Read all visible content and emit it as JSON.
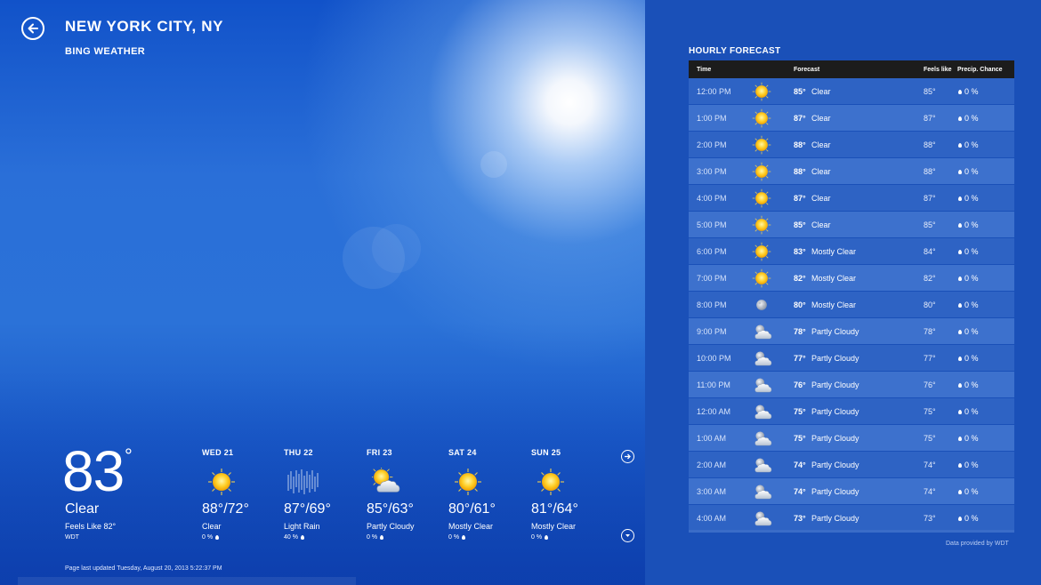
{
  "header": {
    "city": "NEW YORK CITY, NY",
    "app_name": "BING WEATHER"
  },
  "current": {
    "temp": "83",
    "degree": "°",
    "condition": "Clear",
    "feels_like": "Feels Like 82°",
    "provider": "WDT",
    "updated": "Page last updated Tuesday, August 20, 2013 5:22:37 PM"
  },
  "daily": [
    {
      "day": "WED 21",
      "temp": "88°/72°",
      "cond": "Clear",
      "precip": "0 %",
      "icon": "sun-icon"
    },
    {
      "day": "THU 22",
      "temp": "87°/69°",
      "cond": "Light Rain",
      "precip": "40 %",
      "icon": "rain-icon"
    },
    {
      "day": "FRI 23",
      "temp": "85°/63°",
      "cond": "Partly Cloudy",
      "precip": "0 %",
      "icon": "partly-cloudy-icon"
    },
    {
      "day": "SAT 24",
      "temp": "80°/61°",
      "cond": "Mostly Clear",
      "precip": "0 %",
      "icon": "sun-icon"
    },
    {
      "day": "SUN 25",
      "temp": "81°/64°",
      "cond": "Mostly Clear",
      "precip": "0 %",
      "icon": "sun-icon"
    }
  ],
  "hourly": {
    "title": "HOURLY FORECAST",
    "headers": {
      "time": "Time",
      "forecast": "Forecast",
      "feels": "Feels like",
      "precip": "Precip. Chance"
    },
    "rows": [
      {
        "time": "12:00 PM",
        "temp": "85°",
        "cond": "Clear",
        "feels": "85°",
        "precip": "0 %",
        "icon": "sun-icon"
      },
      {
        "time": "1:00 PM",
        "temp": "87°",
        "cond": "Clear",
        "feels": "87°",
        "precip": "0 %",
        "icon": "sun-icon"
      },
      {
        "time": "2:00 PM",
        "temp": "88°",
        "cond": "Clear",
        "feels": "88°",
        "precip": "0 %",
        "icon": "sun-icon"
      },
      {
        "time": "3:00 PM",
        "temp": "88°",
        "cond": "Clear",
        "feels": "88°",
        "precip": "0 %",
        "icon": "sun-icon"
      },
      {
        "time": "4:00 PM",
        "temp": "87°",
        "cond": "Clear",
        "feels": "87°",
        "precip": "0 %",
        "icon": "sun-icon"
      },
      {
        "time": "5:00 PM",
        "temp": "85°",
        "cond": "Clear",
        "feels": "85°",
        "precip": "0 %",
        "icon": "sun-icon"
      },
      {
        "time": "6:00 PM",
        "temp": "83°",
        "cond": "Mostly Clear",
        "feels": "84°",
        "precip": "0 %",
        "icon": "sun-icon"
      },
      {
        "time": "7:00 PM",
        "temp": "82°",
        "cond": "Mostly Clear",
        "feels": "82°",
        "precip": "0 %",
        "icon": "sun-icon"
      },
      {
        "time": "8:00 PM",
        "temp": "80°",
        "cond": "Mostly Clear",
        "feels": "80°",
        "precip": "0 %",
        "icon": "moon-icon"
      },
      {
        "time": "9:00 PM",
        "temp": "78°",
        "cond": "Partly Cloudy",
        "feels": "78°",
        "precip": "0 %",
        "icon": "night-cloud-icon"
      },
      {
        "time": "10:00 PM",
        "temp": "77°",
        "cond": "Partly Cloudy",
        "feels": "77°",
        "precip": "0 %",
        "icon": "night-cloud-icon"
      },
      {
        "time": "11:00 PM",
        "temp": "76°",
        "cond": "Partly Cloudy",
        "feels": "76°",
        "precip": "0 %",
        "icon": "night-cloud-icon"
      },
      {
        "time": "12:00 AM",
        "temp": "75°",
        "cond": "Partly Cloudy",
        "feels": "75°",
        "precip": "0 %",
        "icon": "night-cloud-icon"
      },
      {
        "time": "1:00 AM",
        "temp": "75°",
        "cond": "Partly Cloudy",
        "feels": "75°",
        "precip": "0 %",
        "icon": "night-cloud-icon"
      },
      {
        "time": "2:00 AM",
        "temp": "74°",
        "cond": "Partly Cloudy",
        "feels": "74°",
        "precip": "0 %",
        "icon": "night-cloud-icon"
      },
      {
        "time": "3:00 AM",
        "temp": "74°",
        "cond": "Partly Cloudy",
        "feels": "74°",
        "precip": "0 %",
        "icon": "night-cloud-icon"
      },
      {
        "time": "4:00 AM",
        "temp": "73°",
        "cond": "Partly Cloudy",
        "feels": "73°",
        "precip": "0 %",
        "icon": "night-cloud-icon"
      }
    ],
    "attribution": "Data provided by WDT"
  },
  "colors": {
    "panel_bg": "#1a50b8",
    "header_bg": "#1c1c1c",
    "row_a": "#2e63c4",
    "row_b": "#3d71cd"
  }
}
